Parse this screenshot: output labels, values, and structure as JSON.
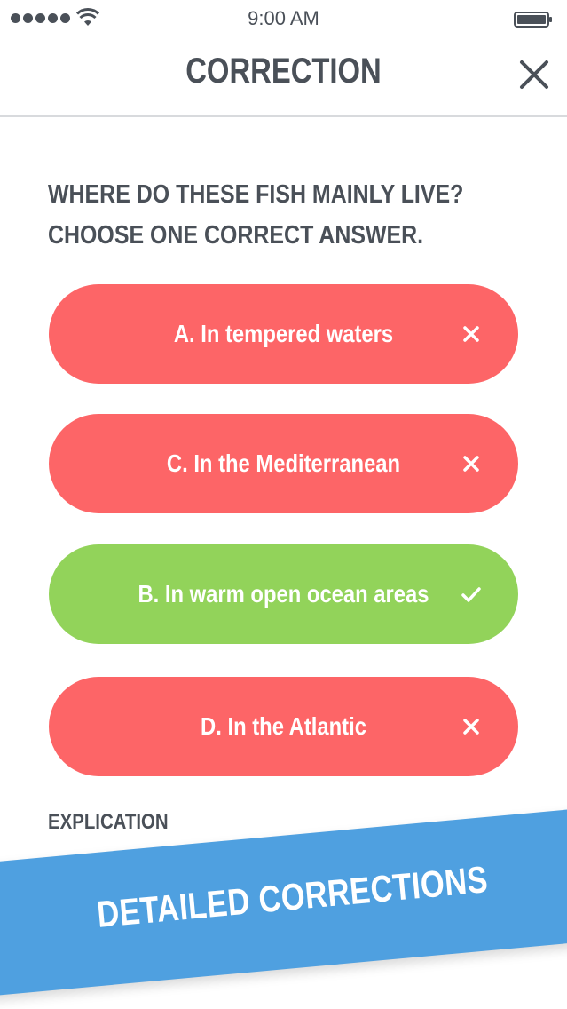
{
  "status_bar": {
    "time": "9:00 AM",
    "signal_icon": "signal-dots-icon",
    "wifi_icon": "wifi-icon",
    "battery_icon": "battery-icon"
  },
  "header": {
    "title": "CORRECTION",
    "close_icon": "close-icon"
  },
  "question": {
    "line1": "WHERE DO THESE FISH MAINLY LIVE?",
    "line2": "CHOOSE ONE CORRECT ANSWER."
  },
  "answers": [
    {
      "label": "A. In tempered waters",
      "status": "wrong",
      "icon": "cross-icon"
    },
    {
      "label": "C. In the Mediterranean",
      "status": "wrong",
      "icon": "cross-icon"
    },
    {
      "label": "B. In warm open ocean areas",
      "status": "correct",
      "icon": "check-icon"
    },
    {
      "label": "D. In the Atlantic",
      "status": "wrong",
      "icon": "cross-icon"
    }
  ],
  "explication": {
    "label": "EXPLICATION"
  },
  "banner": {
    "text": "DETAILED CORRECTIONS"
  },
  "colors": {
    "wrong": "#fd6567",
    "correct": "#92d35a",
    "banner": "#4fa0e0",
    "text": "#4a5058"
  }
}
